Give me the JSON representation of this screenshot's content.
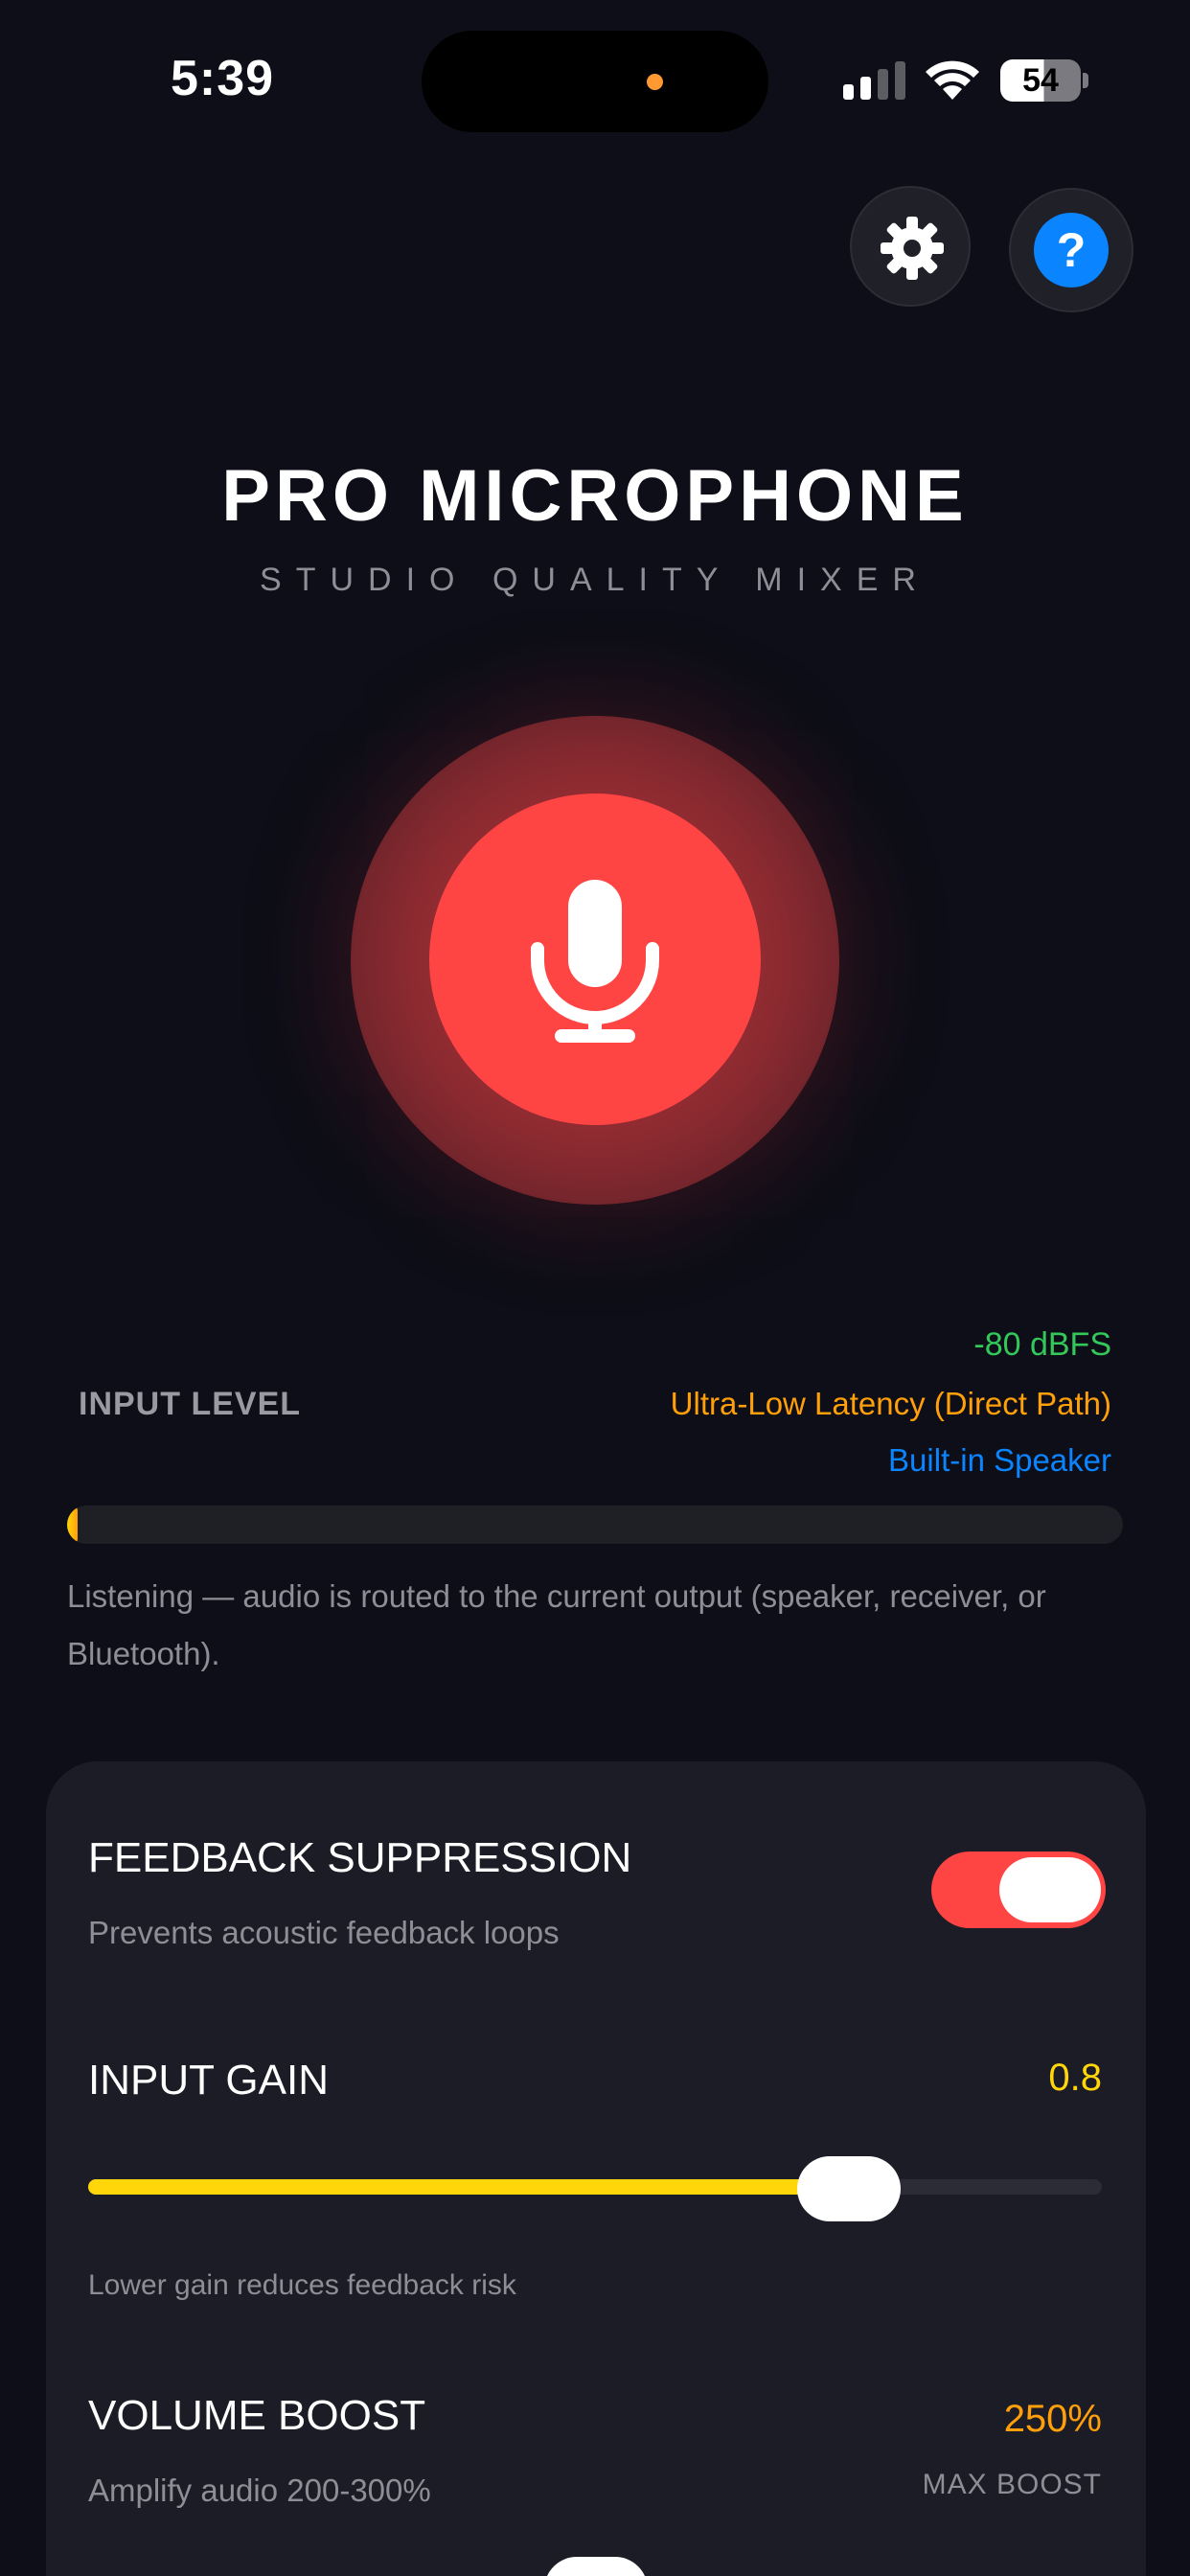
{
  "status_bar": {
    "time": "5:39",
    "battery": "54",
    "icons": [
      "signal-icon",
      "wifi-icon",
      "battery-icon"
    ]
  },
  "header": {
    "settings_icon": "gear-icon",
    "help_icon": "question-mark-icon",
    "help_glyph": "?"
  },
  "title": {
    "main": "PRO MICROPHONE",
    "subtitle": "STUDIO QUALITY MIXER"
  },
  "mic": {
    "icon": "microphone-icon",
    "active_color": "#ff4444"
  },
  "input": {
    "label": "INPUT LEVEL",
    "dbfs": "-80 dBFS",
    "latency": "Ultra-Low Latency (Direct Path)",
    "output_device": "Built-in Speaker",
    "level_fraction": 0.01,
    "status": "Listening — audio is routed to the current output (speaker, receiver, or Bluetooth)."
  },
  "settings": {
    "feedback": {
      "title": "FEEDBACK SUPPRESSION",
      "description": "Prevents acoustic feedback loops",
      "enabled": true
    },
    "gain": {
      "title": "INPUT GAIN",
      "value": "0.8",
      "slider_fraction": 0.75,
      "hint": "Lower gain reduces feedback risk"
    },
    "boost": {
      "title": "VOLUME BOOST",
      "value": "250%",
      "description": "Amplify audio 200-300%",
      "tag": "MAX BOOST"
    }
  },
  "colors": {
    "background": "#0d0e17",
    "accent_red": "#ff4444",
    "level_green": "#34c759",
    "latency_orange": "#ff9f0a",
    "device_blue": "#0a84ff",
    "gain_yellow": "#ffd60a"
  }
}
